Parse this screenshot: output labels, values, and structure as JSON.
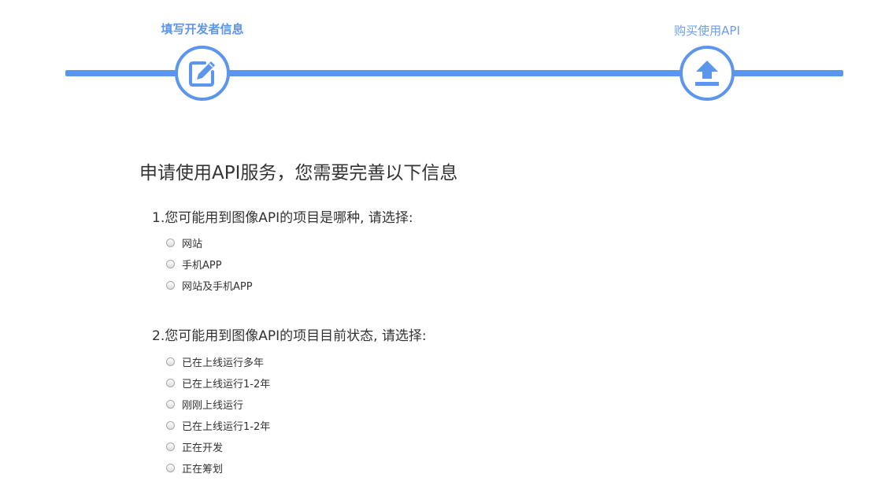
{
  "stepper": {
    "steps": [
      {
        "label": "填写开发者信息",
        "icon": "edit-icon",
        "state": "active"
      },
      {
        "label": "购买使用API",
        "icon": "upload-icon",
        "state": "pending"
      }
    ],
    "accent_color": "#5c95ec"
  },
  "form": {
    "title": "申请使用API服务，您需要完善以下信息",
    "questions": [
      {
        "text": "1.您可能用到图像API的项目是哪种, 请选择:",
        "options": [
          "网站",
          "手机APP",
          "网站及手机APP"
        ],
        "selected": null
      },
      {
        "text": "2.您可能用到图像API的项目目前状态, 请选择:",
        "options": [
          "已在上线运行多年",
          "已在上线运行1-2年",
          "刚刚上线运行",
          "已在上线运行1-2年",
          "正在开发",
          "正在筹划"
        ],
        "selected": null
      }
    ]
  }
}
